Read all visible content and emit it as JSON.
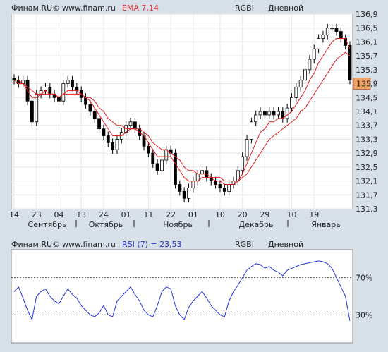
{
  "top": {
    "source": "Финам.RU©",
    "site": "www.finam.ru",
    "indicator": "EMA 7,14",
    "ticker": "RGBI",
    "period": "Дневной"
  },
  "bottom": {
    "source": "Финам.RU©",
    "site": "www.finam.ru",
    "indicator": "RSI (7) = 23,53",
    "ticker": "RGBI",
    "period": "Дневной"
  },
  "colors": {
    "up_candle": "#ffffff",
    "down_candle": "#000000",
    "ema": "#e02020",
    "rsi": "#2233dd",
    "last_price_bg": "#f0a060",
    "plot_bg": "#ffffff",
    "page_bg": "#d7dfe9"
  },
  "chart_data": [
    {
      "type": "candlestick",
      "title": "EMA 7,14",
      "y_ticks": [
        "136,9",
        "136,5",
        "136,1",
        "135,7",
        "135,3",
        "134,9",
        "134,5",
        "134,1",
        "133,7",
        "133,3",
        "132,9",
        "132,5",
        "132,1",
        "131,7",
        "131,3"
      ],
      "ylim": [
        131.3,
        136.9
      ],
      "x_ticks": [
        "14",
        "23",
        "04",
        "13",
        "24",
        "01",
        "11",
        "22",
        "01",
        "10",
        "20",
        "29",
        "10",
        "19"
      ],
      "months": [
        "Сентябрь",
        "Октябрь",
        "Ноябрь",
        "Декабрь",
        "Январь"
      ],
      "last_price_label": "135",
      "last_price": 134.9,
      "series": [
        {
          "name": "Close",
          "values": [
            135.0,
            134.9,
            135.0,
            134.4,
            133.8,
            134.6,
            134.7,
            134.8,
            134.6,
            134.5,
            134.4,
            134.9,
            135.0,
            134.8,
            134.7,
            134.5,
            134.3,
            134.1,
            133.9,
            133.6,
            133.4,
            133.2,
            133.0,
            133.3,
            133.5,
            133.7,
            133.8,
            133.6,
            133.4,
            133.1,
            132.9,
            132.6,
            132.4,
            132.7,
            133.0,
            132.9,
            132.0,
            131.8,
            131.6,
            131.9,
            132.1,
            132.3,
            132.4,
            132.2,
            132.1,
            132.0,
            131.9,
            131.8,
            132.0,
            132.1,
            132.4,
            132.8,
            133.3,
            133.8,
            134.0,
            134.1,
            134.0,
            134.1,
            134.0,
            134.1,
            133.9,
            134.2,
            134.5,
            134.8,
            135.0,
            135.3,
            135.6,
            135.9,
            136.2,
            136.3,
            136.5,
            136.5,
            136.4,
            136.2,
            136.0,
            135.0
          ],
          "x_range": [
            "14 Sep",
            "Jan 23"
          ]
        },
        {
          "name": "EMA 7",
          "values": [
            135.0,
            134.9,
            134.9,
            134.7,
            134.5,
            134.5,
            134.6,
            134.7,
            134.6,
            134.6,
            134.5,
            134.6,
            134.7,
            134.7,
            134.7,
            134.6,
            134.5,
            134.4,
            134.2,
            134.0,
            133.8,
            133.6,
            133.4,
            133.4,
            133.4,
            133.5,
            133.6,
            133.6,
            133.5,
            133.4,
            133.2,
            133.0,
            132.8,
            132.8,
            132.8,
            132.8,
            132.6,
            132.4,
            132.2,
            132.1,
            132.1,
            132.1,
            132.2,
            132.2,
            132.2,
            132.1,
            132.1,
            132.0,
            132.0,
            132.0,
            132.1,
            132.3,
            132.6,
            132.9,
            133.2,
            133.5,
            133.6,
            133.8,
            133.8,
            133.9,
            133.9,
            134.0,
            134.1,
            134.3,
            134.5,
            134.7,
            135.0,
            135.2,
            135.5,
            135.7,
            135.9,
            136.1,
            136.2,
            136.2,
            136.2,
            135.9
          ]
        },
        {
          "name": "EMA 14",
          "values": [
            135.0,
            135.0,
            134.9,
            134.8,
            134.7,
            134.6,
            134.6,
            134.6,
            134.6,
            134.6,
            134.5,
            134.6,
            134.6,
            134.6,
            134.6,
            134.6,
            134.5,
            134.5,
            134.4,
            134.2,
            134.1,
            133.9,
            133.8,
            133.7,
            133.7,
            133.6,
            133.6,
            133.6,
            133.6,
            133.5,
            133.4,
            133.2,
            133.1,
            133.0,
            133.0,
            132.9,
            132.8,
            132.7,
            132.5,
            132.4,
            132.4,
            132.3,
            132.3,
            132.3,
            132.2,
            132.2,
            132.2,
            132.1,
            132.1,
            132.1,
            132.1,
            132.2,
            132.3,
            132.5,
            132.7,
            132.9,
            133.1,
            133.3,
            133.4,
            133.5,
            133.6,
            133.7,
            133.8,
            133.9,
            134.1,
            134.2,
            134.4,
            134.6,
            134.8,
            135.0,
            135.2,
            135.4,
            135.6,
            135.7,
            135.8,
            135.7
          ]
        }
      ]
    },
    {
      "type": "line",
      "title": "RSI (7) = 23,53",
      "y_ticks": [
        "70%",
        "30%"
      ],
      "ylim": [
        0,
        100
      ],
      "levels": [
        70,
        30
      ],
      "series": [
        {
          "name": "RSI (7)",
          "values": [
            55,
            60,
            48,
            35,
            25,
            50,
            55,
            58,
            50,
            45,
            42,
            50,
            58,
            52,
            48,
            40,
            35,
            30,
            28,
            32,
            40,
            30,
            28,
            45,
            50,
            55,
            60,
            52,
            45,
            35,
            30,
            28,
            40,
            55,
            60,
            58,
            40,
            30,
            25,
            38,
            45,
            50,
            55,
            48,
            40,
            35,
            30,
            28,
            45,
            55,
            62,
            70,
            78,
            82,
            85,
            84,
            80,
            82,
            78,
            76,
            72,
            78,
            80,
            82,
            84,
            85,
            86,
            87,
            88,
            87,
            85,
            80,
            70,
            60,
            50,
            23.53
          ]
        }
      ]
    }
  ]
}
